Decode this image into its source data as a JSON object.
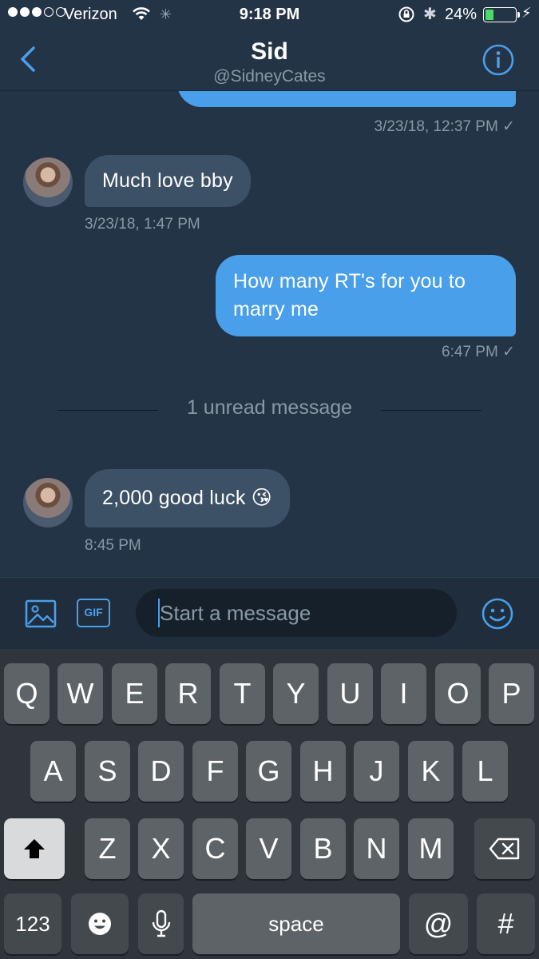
{
  "status_bar": {
    "carrier": "Verizon",
    "time": "9:18 PM",
    "battery": "24%",
    "battery_level": 0.24,
    "icons": [
      "signal-dots-icon",
      "wifi-icon",
      "activity-spinner-icon",
      "rotation-lock-icon",
      "bluetooth-icon",
      "battery-icon",
      "charging-bolt-icon"
    ]
  },
  "header": {
    "name": "Sid",
    "handle": "@SidneyCates",
    "back_icon": "chevron-left-icon",
    "info_icon": "info-icon"
  },
  "messages": [
    {
      "direction": "outgoing",
      "text": "",
      "meta": "3/23/18, 12:37 PM ✓"
    },
    {
      "direction": "incoming",
      "text": "Much love bby",
      "meta": "3/23/18, 1:47 PM"
    },
    {
      "direction": "outgoing",
      "text": "How many RT's for you to marry me",
      "meta": "6:47 PM ✓"
    },
    {
      "direction": "incoming",
      "text": "2,000 good luck 😘",
      "meta": "8:45 PM"
    }
  ],
  "unread_divider": "1 unread message",
  "composer": {
    "placeholder": "Start a message",
    "gif_label": "GIF",
    "icons": [
      "image-icon",
      "gif-icon",
      "smiley-icon"
    ]
  },
  "keyboard": {
    "row1": [
      "Q",
      "W",
      "E",
      "R",
      "T",
      "Y",
      "U",
      "I",
      "O",
      "P"
    ],
    "row2": [
      "A",
      "S",
      "D",
      "F",
      "G",
      "H",
      "J",
      "K",
      "L"
    ],
    "row3": [
      "Z",
      "X",
      "C",
      "V",
      "B",
      "N",
      "M"
    ],
    "numbers_label": "123",
    "space_label": "space",
    "at_label": "@",
    "hash_label": "#",
    "icons": [
      "shift-icon",
      "backspace-icon",
      "emoji-icon",
      "microphone-icon"
    ]
  },
  "colors": {
    "background": "#243447",
    "accent": "#4a9fea",
    "incoming_bubble": "#3d5166",
    "secondary_text": "#8899a6"
  }
}
